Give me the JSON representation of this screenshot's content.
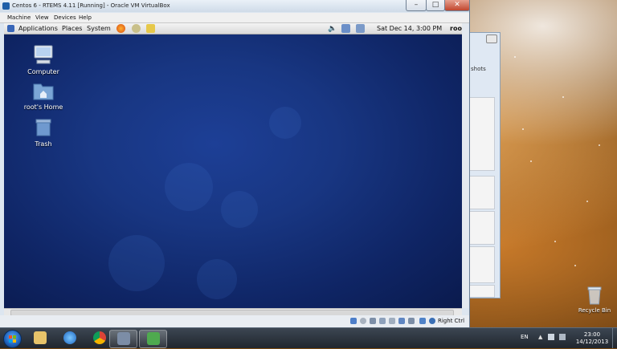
{
  "window": {
    "title": "Centos 6 - RTEMS 4.11 [Running] - Oracle VM VirtualBox",
    "minimize_icon": "minimize-icon",
    "maximize_icon": "maximize-icon",
    "close_icon": "close-icon"
  },
  "menubar": {
    "items": [
      "Machine",
      "View",
      "Devices",
      "Help"
    ]
  },
  "guest": {
    "panel": {
      "applications": "Applications",
      "places": "Places",
      "system": "System",
      "datetime": "Sat Dec 14,  3:00 PM",
      "user": "roo"
    },
    "desktop_icons": [
      {
        "label": "Computer",
        "icon": "computer-icon"
      },
      {
        "label": "root's Home",
        "icon": "home-folder-icon"
      },
      {
        "label": "Trash",
        "icon": "trash-icon"
      }
    ]
  },
  "statusbar": {
    "host_key": "Right Ctrl"
  },
  "background_window": {
    "partial_text": "shots"
  },
  "desktop": {
    "recycle_bin": "Recycle Bin"
  },
  "taskbar": {
    "apps": [
      "windows-explorer-icon",
      "ie-icon",
      "chrome-icon",
      "virtualbox-icon",
      "snipping-tool-icon"
    ],
    "language": "EN",
    "time": "23:00",
    "date": "14/12/2013"
  },
  "colors": {
    "gnome_desktop": "#183682",
    "vbox_frame": "#dde6f0",
    "taskbar": "#2a323c",
    "close_button": "#c1462e"
  }
}
